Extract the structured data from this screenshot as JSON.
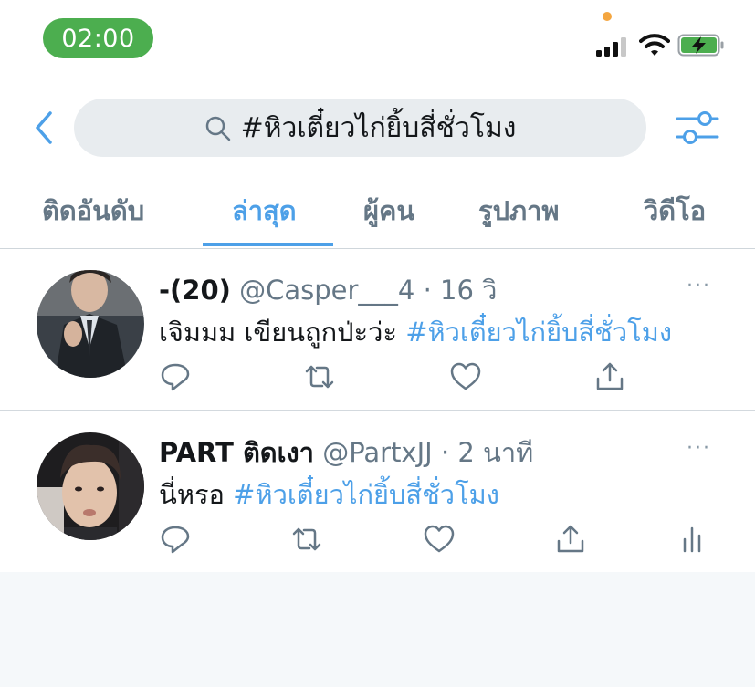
{
  "status_bar": {
    "time": "02:00",
    "colors": {
      "time_pill": "#4cae4f",
      "battery_fill": "#4cae4f",
      "privacy_dot": "#f4a640"
    }
  },
  "search": {
    "query": "#หิวเตี๋ยวไก่ยิ้บสี่ชั่วโมง",
    "icons": {
      "back": "chevron-left-icon",
      "search": "magnifier-icon",
      "filter": "sliders-icon"
    }
  },
  "tabs": [
    {
      "label": "ติดอันดับ",
      "active": false
    },
    {
      "label": "ล่าสุด",
      "active": true
    },
    {
      "label": "ผู้คน",
      "active": false
    },
    {
      "label": "รูปภาพ",
      "active": false
    },
    {
      "label": "วิดีโอ",
      "active": false
    }
  ],
  "accent_color": "#4da0e8",
  "tweets": [
    {
      "display_name": "-(20)",
      "handle": "@Casper___4",
      "separator": "·",
      "time": "16 วิ",
      "text": "เจิมมม เขียนถูกป่ะว่ะ",
      "hashtag": "#หิวเตี๋ยวไก่ยิ้บสี่ชั่วโมง",
      "more": "···",
      "actions": [
        "reply-icon",
        "retweet-icon",
        "like-icon",
        "share-icon"
      ]
    },
    {
      "display_name": "PART ติดเงา",
      "handle": "@PartxJJ",
      "separator": "·",
      "time": "2 นาที",
      "text": "นี่หรอ",
      "hashtag": "#หิวเตี๋ยวไก่ยิ้บสี่ชั่วโมง",
      "more": "···",
      "actions": [
        "reply-icon",
        "retweet-icon",
        "like-icon",
        "share-icon",
        "analytics-icon"
      ]
    }
  ]
}
